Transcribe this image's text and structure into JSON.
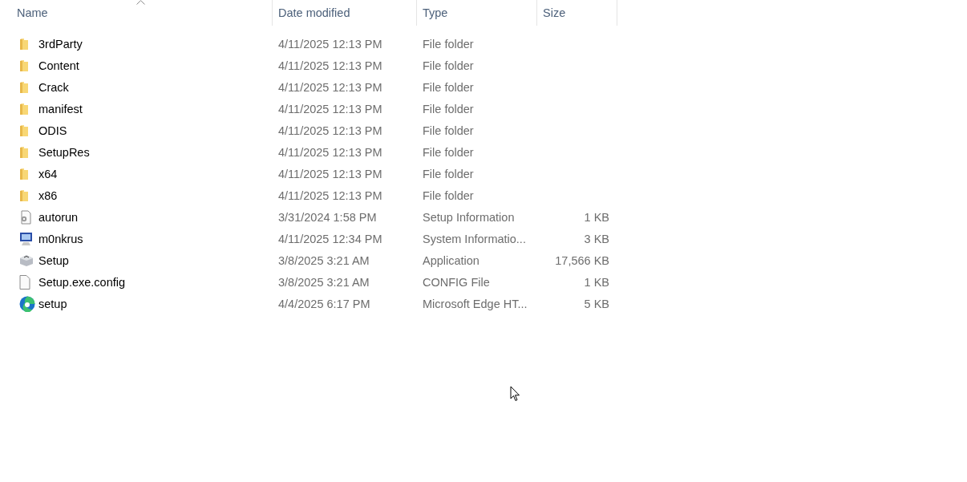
{
  "columns": [
    {
      "label": "Name",
      "sorted": true
    },
    {
      "label": "Date modified",
      "sorted": false
    },
    {
      "label": "Type",
      "sorted": false
    },
    {
      "label": "Size",
      "sorted": false
    }
  ],
  "rows": [
    {
      "kind": "folder",
      "name": "3rdParty",
      "date": "4/11/2025 12:13 PM",
      "type": "File folder"
    },
    {
      "kind": "folder",
      "name": "Content",
      "date": "4/11/2025 12:13 PM",
      "type": "File folder"
    },
    {
      "kind": "folder",
      "name": "Crack",
      "date": "4/11/2025 12:13 PM",
      "type": "File folder"
    },
    {
      "kind": "folder",
      "name": "manifest",
      "date": "4/11/2025 12:13 PM",
      "type": "File folder"
    },
    {
      "kind": "folder",
      "name": "ODIS",
      "date": "4/11/2025 12:13 PM",
      "type": "File folder"
    },
    {
      "kind": "folder",
      "name": "SetupRes",
      "date": "4/11/2025 12:13 PM",
      "type": "File folder"
    },
    {
      "kind": "folder",
      "name": "x64",
      "date": "4/11/2025 12:13 PM",
      "type": "File folder"
    },
    {
      "kind": "folder",
      "name": "x86",
      "date": "4/11/2025 12:13 PM",
      "type": "File folder"
    },
    {
      "kind": "settings",
      "name": "autorun",
      "date": "3/31/2024 1:58 PM",
      "type": "Setup Information",
      "size": "1 KB"
    },
    {
      "kind": "sysinfo",
      "name": "m0nkrus",
      "date": "4/11/2025 12:34 PM",
      "type": "System Informatio...",
      "size": "3 KB"
    },
    {
      "kind": "installer",
      "name": "Setup",
      "date": "3/8/2025 3:21 AM",
      "type": "Application",
      "size": "17,566 KB"
    },
    {
      "kind": "file",
      "name": "Setup.exe.config",
      "date": "3/8/2025 3:21 AM",
      "type": "CONFIG File",
      "size": "1 KB"
    },
    {
      "kind": "edge",
      "name": "setup",
      "date": "4/4/2025 6:17 PM",
      "type": "Microsoft Edge HT...",
      "size": "5 KB"
    }
  ]
}
